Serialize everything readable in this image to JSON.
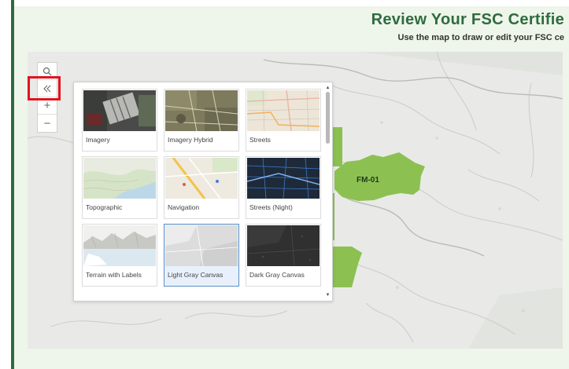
{
  "header": {
    "title": "Review Your FSC Certifie",
    "subtitle": "Use the map to draw or edit your FSC ce"
  },
  "map": {
    "parcel_label": "FM-01",
    "parcel_color": "#8cc152",
    "tools": {
      "search_icon": "search-icon",
      "collapse_icon": "double-chevron-left-icon",
      "zoom_in": "+",
      "zoom_out": "−"
    }
  },
  "basemap_gallery": {
    "selected": "Light Gray Canvas",
    "items": [
      {
        "label": "Imagery"
      },
      {
        "label": "Imagery Hybrid"
      },
      {
        "label": "Streets"
      },
      {
        "label": "Topographic"
      },
      {
        "label": "Navigation"
      },
      {
        "label": "Streets (Night)"
      },
      {
        "label": "Terrain with Labels"
      },
      {
        "label": "Light Gray Canvas"
      },
      {
        "label": "Dark Gray Canvas"
      }
    ]
  },
  "colors": {
    "accent": "#2f6b3f",
    "highlight": "#e0141e",
    "background": "#eef5ea"
  }
}
